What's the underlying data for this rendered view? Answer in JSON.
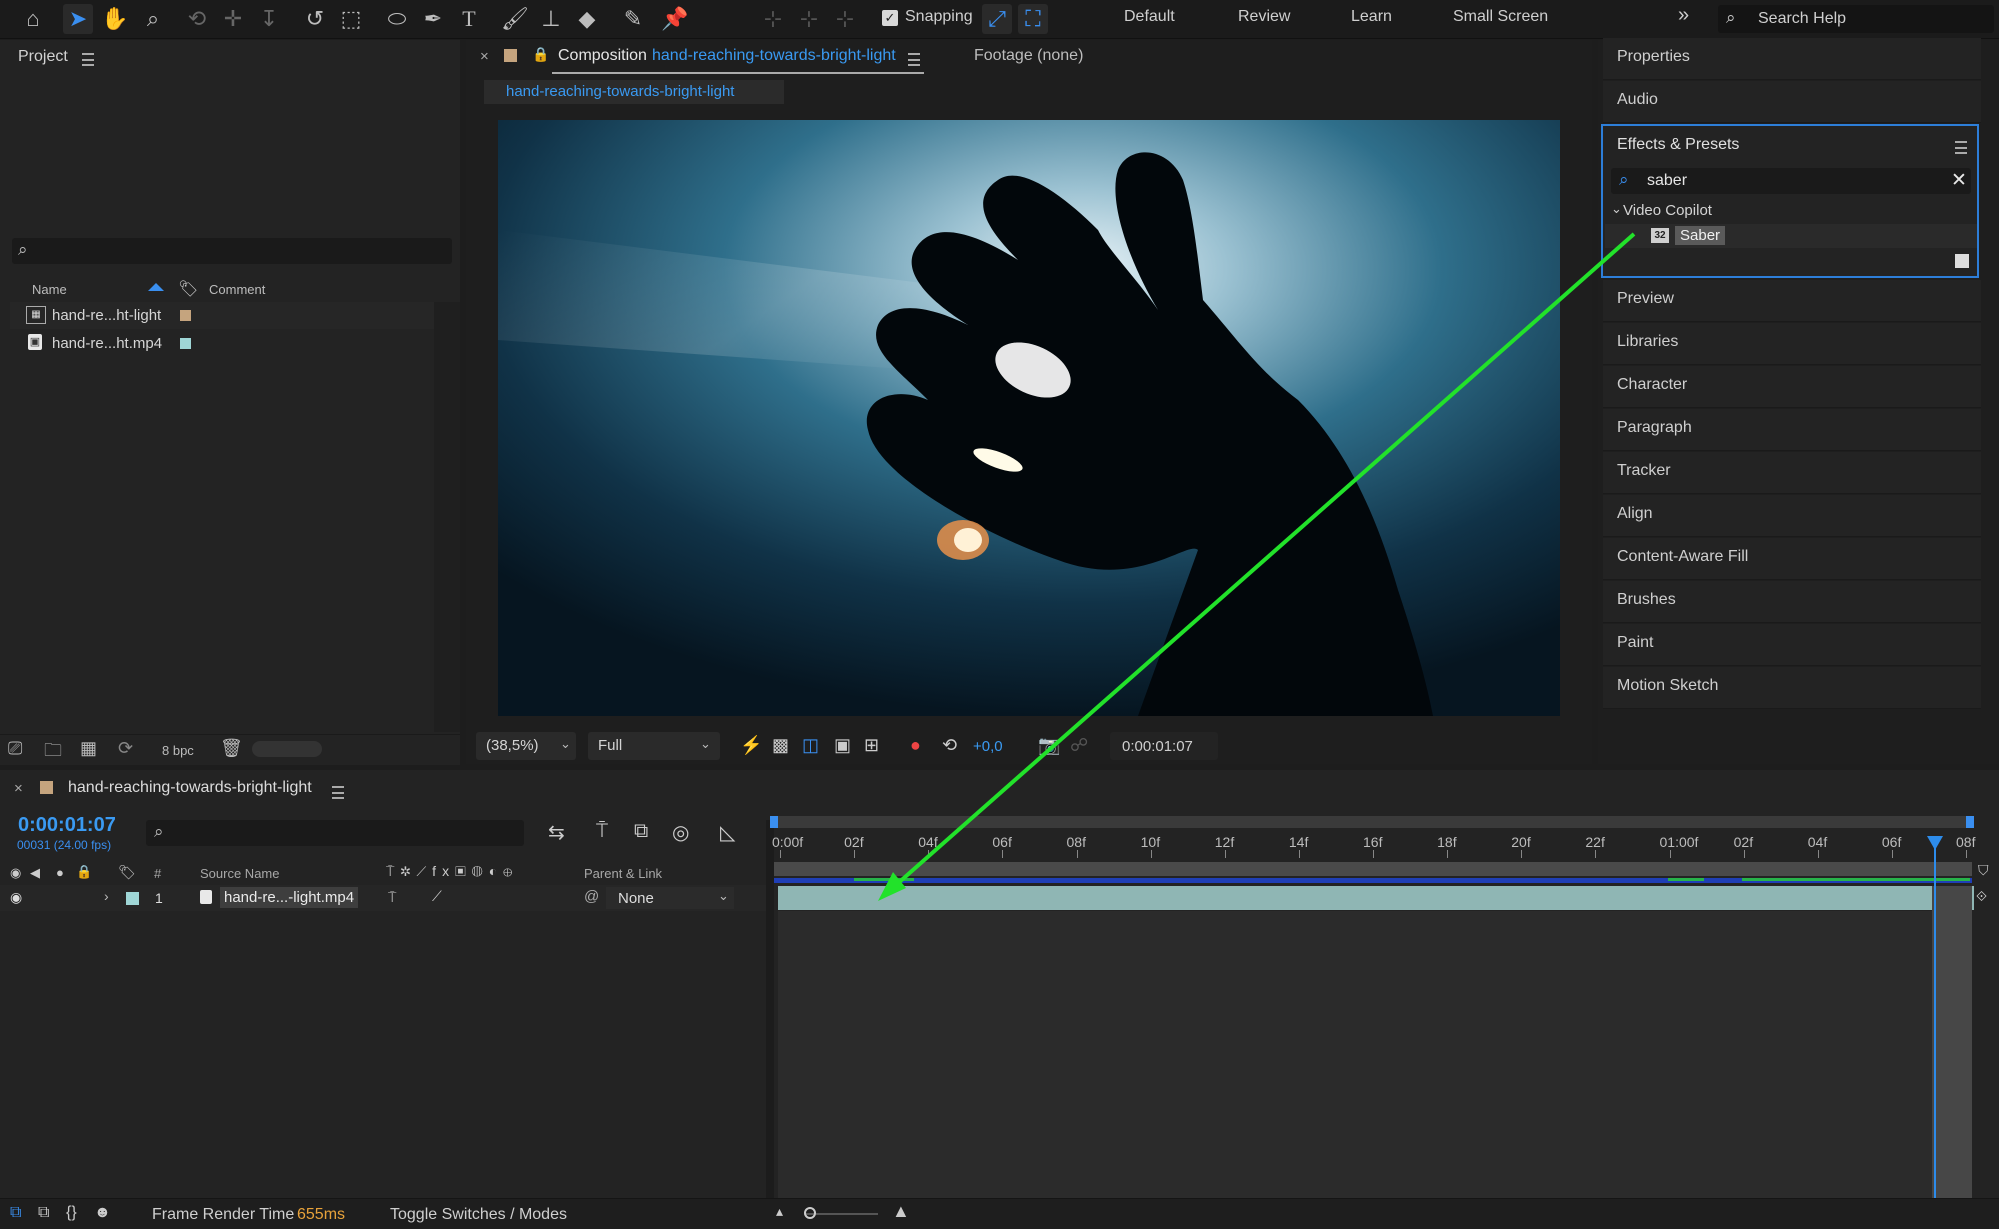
{
  "toolbar": {
    "snapping_label": "Snapping",
    "workspaces": [
      "Default",
      "Review",
      "Learn",
      "Small Screen"
    ],
    "more": "»",
    "search_help_placeholder": "Search Help"
  },
  "project": {
    "title": "Project",
    "columns": {
      "name": "Name",
      "comment": "Comment"
    },
    "items": [
      {
        "name": "hand-re...ht-light",
        "swatch": "#c5a47e",
        "icon": "composition-icon"
      },
      {
        "name": "hand-re...ht.mp4",
        "swatch": "#9fd6d6",
        "icon": "footage-icon"
      }
    ],
    "bpc": "8 bpc"
  },
  "composition": {
    "tab_prefix": "Composition",
    "tab_name": "hand-reaching-towards-bright-light",
    "footage_tab": "Footage (none)",
    "breadcrumb": "hand-reaching-towards-bright-light",
    "zoom": "(38,5%)",
    "resolution": "Full",
    "exposure": "+0,0",
    "timecode": "0:00:01:07"
  },
  "right_panel": {
    "properties": "Properties",
    "audio": "Audio",
    "effects_title": "Effects & Presets",
    "search_value": "saber",
    "group": "Video Copilot",
    "effect": "Saber",
    "effect_badge": "32",
    "items": [
      "Preview",
      "Libraries",
      "Character",
      "Paragraph",
      "Tracker",
      "Align",
      "Content-Aware Fill",
      "Brushes",
      "Paint",
      "Motion Sketch"
    ]
  },
  "timeline": {
    "title": "hand-reaching-towards-bright-light",
    "timecode": "0:00:01:07",
    "frames": "00031 (24.00 fps)",
    "columns": {
      "num": "#",
      "source": "Source Name",
      "parent": "Parent & Link"
    },
    "layer": {
      "num": "1",
      "name": "hand-re...-light.mp4",
      "parent": "None",
      "swatch": "#9fd6d6"
    },
    "ticks": [
      "0:00f",
      "02f",
      "04f",
      "06f",
      "08f",
      "10f",
      "12f",
      "14f",
      "16f",
      "18f",
      "20f",
      "22f",
      "01:00f",
      "02f",
      "04f",
      "06f",
      "08f"
    ],
    "playhead_fraction": 0.968
  },
  "status": {
    "render_label": "Frame Render Time",
    "render_value": "655ms",
    "toggle": "Toggle Switches / Modes"
  },
  "colors": {
    "accent_blue": "#2d8ceb",
    "arrow_green": "#22e22a",
    "render_orange": "#e8a23a"
  }
}
